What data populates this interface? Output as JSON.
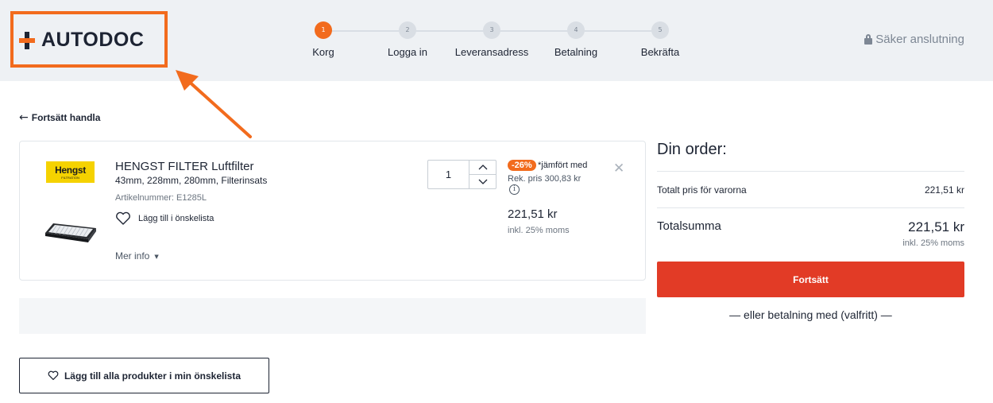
{
  "header": {
    "logo_text": "AUTODOC",
    "secure_label": "Säker anslutning",
    "steps": [
      {
        "number": "1",
        "label": "Korg",
        "active": true
      },
      {
        "number": "2",
        "label": "Logga in",
        "active": false
      },
      {
        "number": "3",
        "label": "Leveransadress",
        "active": false
      },
      {
        "number": "4",
        "label": "Betalning",
        "active": false
      },
      {
        "number": "5",
        "label": "Bekräfta",
        "active": false
      }
    ]
  },
  "nav": {
    "back_label": "Fortsätt handla"
  },
  "product": {
    "brand_logo_text": "Hengst",
    "brand_logo_subtext": "FILTRATION",
    "title": "HENGST FILTER Luftfilter",
    "specs": "43mm, 228mm, 280mm, Filterinsats",
    "article": "Artikelnummer: E1285L",
    "wishlist_label": "Lägg till i önskelista",
    "more_info_label": "Mer info",
    "quantity": "1",
    "discount_badge": "-26%",
    "discount_text": "*jämfört med",
    "rek_price": "Rek. pris 300,83 kr",
    "info_glyph": "i",
    "price": "221,51 kr",
    "price_moms": "inkl. 25% moms"
  },
  "wishlist_all_label": "Lägg till alla produkter i min önskelista",
  "order": {
    "title": "Din order:",
    "subtotal_label": "Totalt pris för varorna",
    "subtotal_value": "221,51 kr",
    "total_label": "Totalsumma",
    "total_value": "221,51 kr",
    "total_moms": "inkl. 25% moms",
    "continue_label": "Fortsätt",
    "alt_payment": "— eller betalning med (valfritt) —"
  },
  "colors": {
    "accent_orange": "#f26b1d",
    "cta_red": "#e23b26",
    "header_bg": "#eef1f4"
  }
}
